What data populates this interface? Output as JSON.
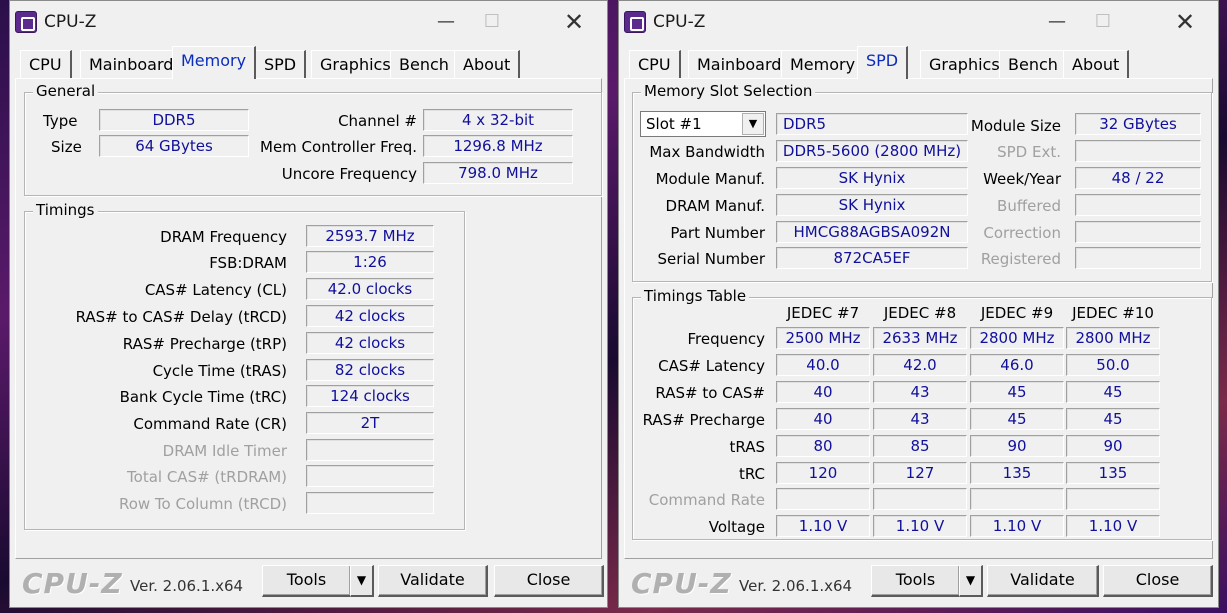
{
  "left_window": {
    "title": "CPU-Z",
    "tabs": [
      "CPU",
      "Mainboard",
      "Memory",
      "SPD",
      "Graphics",
      "Bench",
      "About"
    ],
    "active_tab": "Memory",
    "general": {
      "group_title": "General",
      "type_label": "Type",
      "type_value": "DDR5",
      "size_label": "Size",
      "size_value": "64 GBytes",
      "channel_label": "Channel #",
      "channel_value": "4 x 32-bit",
      "mem_ctrl_label": "Mem Controller Freq.",
      "mem_ctrl_value": "1296.8 MHz",
      "uncore_label": "Uncore Frequency",
      "uncore_value": "798.0 MHz"
    },
    "timings": {
      "group_title": "Timings",
      "rows": [
        {
          "label": "DRAM Frequency",
          "value": "2593.7 MHz"
        },
        {
          "label": "FSB:DRAM",
          "value": "1:26"
        },
        {
          "label": "CAS# Latency (CL)",
          "value": "42.0 clocks"
        },
        {
          "label": "RAS# to CAS# Delay (tRCD)",
          "value": "42 clocks"
        },
        {
          "label": "RAS# Precharge (tRP)",
          "value": "42 clocks"
        },
        {
          "label": "Cycle Time (tRAS)",
          "value": "82 clocks"
        },
        {
          "label": "Bank Cycle Time (tRC)",
          "value": "124 clocks"
        },
        {
          "label": "Command Rate (CR)",
          "value": "2T"
        },
        {
          "label": "DRAM Idle Timer",
          "value": ""
        },
        {
          "label": "Total CAS# (tRDRAM)",
          "value": ""
        },
        {
          "label": "Row To Column (tRCD)",
          "value": ""
        }
      ]
    },
    "footer": {
      "logo": "CPU-Z",
      "version": "Ver. 2.06.1.x64",
      "tools": "Tools",
      "validate": "Validate",
      "close": "Close"
    }
  },
  "right_window": {
    "title": "CPU-Z",
    "tabs": [
      "CPU",
      "Mainboard",
      "Memory",
      "SPD",
      "Graphics",
      "Bench",
      "About"
    ],
    "active_tab": "SPD",
    "slot": {
      "group_title": "Memory Slot Selection",
      "selected_slot": "Slot #1",
      "type_value": "DDR5",
      "module_size_label": "Module Size",
      "module_size_value": "32 GBytes",
      "max_bw_label": "Max Bandwidth",
      "max_bw_value": "DDR5-5600 (2800 MHz)",
      "spd_ext_label": "SPD Ext.",
      "spd_ext_value": "",
      "module_manuf_label": "Module Manuf.",
      "module_manuf_value": "SK Hynix",
      "week_year_label": "Week/Year",
      "week_year_value": "48 / 22",
      "dram_manuf_label": "DRAM Manuf.",
      "dram_manuf_value": "SK Hynix",
      "buffered_label": "Buffered",
      "buffered_value": "",
      "part_label": "Part Number",
      "part_value": "HMCG88AGBSA092N",
      "correction_label": "Correction",
      "correction_value": "",
      "serial_label": "Serial Number",
      "serial_value": "872CA5EF",
      "registered_label": "Registered",
      "registered_value": ""
    },
    "timings_table": {
      "group_title": "Timings Table",
      "columns": [
        "JEDEC #7",
        "JEDEC #8",
        "JEDEC #9",
        "JEDEC #10"
      ],
      "rows": [
        {
          "label": "Frequency",
          "values": [
            "2500 MHz",
            "2633 MHz",
            "2800 MHz",
            "2800 MHz"
          ]
        },
        {
          "label": "CAS# Latency",
          "values": [
            "40.0",
            "42.0",
            "46.0",
            "50.0"
          ]
        },
        {
          "label": "RAS# to CAS#",
          "values": [
            "40",
            "43",
            "45",
            "45"
          ]
        },
        {
          "label": "RAS# Precharge",
          "values": [
            "40",
            "43",
            "45",
            "45"
          ]
        },
        {
          "label": "tRAS",
          "values": [
            "80",
            "85",
            "90",
            "90"
          ]
        },
        {
          "label": "tRC",
          "values": [
            "120",
            "127",
            "135",
            "135"
          ]
        },
        {
          "label": "Command Rate",
          "values": [
            "",
            "",
            "",
            ""
          ]
        },
        {
          "label": "Voltage",
          "values": [
            "1.10 V",
            "1.10 V",
            "1.10 V",
            "1.10 V"
          ]
        }
      ]
    },
    "footer": {
      "logo": "CPU-Z",
      "version": "Ver. 2.06.1.x64",
      "tools": "Tools",
      "validate": "Validate",
      "close": "Close"
    }
  }
}
